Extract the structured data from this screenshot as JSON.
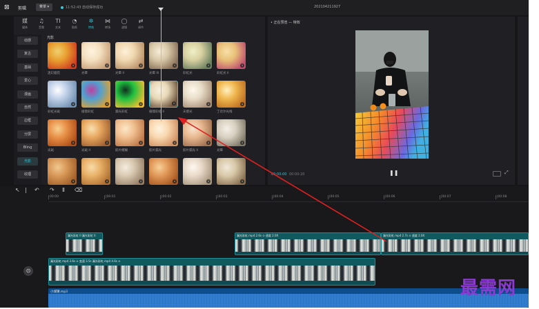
{
  "titlebar": {
    "app_name": "剪辑",
    "menu_label": "菜单 ▾",
    "save_status": "11:52:43 自动保存成功",
    "project_title": "202104211927"
  },
  "categories": [
    {
      "icon": "媒",
      "label": "媒体"
    },
    {
      "icon": "♫",
      "label": "音频"
    },
    {
      "icon": "TI",
      "label": "文本"
    },
    {
      "icon": "◔",
      "label": "贴纸"
    },
    {
      "icon": "✲",
      "label": "特效",
      "active": true
    },
    {
      "icon": "⋈",
      "label": "转场"
    },
    {
      "icon": "◯",
      "label": "滤镜"
    },
    {
      "icon": "⇄",
      "label": "调节"
    }
  ],
  "subnav": [
    "动感",
    "复古",
    "基础",
    "爱心",
    "漫画",
    "自然",
    "边框",
    "分屏",
    "Bling",
    "光影",
    "纹理"
  ],
  "subnav_active_index": 9,
  "grid_heading": "光影",
  "effects": [
    {
      "label": "迷幻烟花",
      "colors": [
        "#e8a030",
        "#d04020",
        "#f0d070"
      ]
    },
    {
      "label": "光晕",
      "colors": [
        "#f4e0c0",
        "#c8a078",
        "#fff4e0"
      ]
    },
    {
      "label": "光晕 II",
      "colors": [
        "#f0d8b0",
        "#b89068",
        "#fff0d8"
      ]
    },
    {
      "label": "光晕 III",
      "colors": [
        "#d8c8a8",
        "#8a7058",
        "#f8ecd8"
      ]
    },
    {
      "label": "彩虹光",
      "colors": [
        "#d8d0a0",
        "#6a8060",
        "#f0f0c8"
      ]
    },
    {
      "label": "彩虹光 II",
      "colors": [
        "#e8c078",
        "#c05070",
        "#f8e0a8"
      ]
    },
    {
      "label": "彩虹光斑",
      "colors": [
        "#c0d0e8",
        "#7090b0",
        "#ffffff"
      ]
    },
    {
      "label": "棱镜彩虹",
      "colors": [
        "#50a0d0",
        "#e0a030",
        "#c040a0"
      ]
    },
    {
      "label": "漏光彩虹",
      "colors": [
        "#20c040",
        "#f0c030",
        "#103020"
      ]
    },
    {
      "label": "棱镜彩虹 II",
      "colors": [
        "#e8d8b8",
        "#705840",
        "#f8f0e0"
      ]
    },
    {
      "label": "天使光",
      "colors": [
        "#e8dcc8",
        "#a89078",
        "#fff8ec"
      ]
    },
    {
      "label": "丁达尔光线",
      "colors": [
        "#f0b850",
        "#c07020",
        "#fff0c0"
      ]
    },
    {
      "label": "光斑",
      "colors": [
        "#e89048",
        "#b05018",
        "#f8d090"
      ]
    },
    {
      "label": "光斑 II",
      "colors": [
        "#e8a860",
        "#a06030",
        "#f8e0b0"
      ]
    },
    {
      "label": "胶片模糊",
      "colors": [
        "#f0c090",
        "#c07848",
        "#fce8c8"
      ]
    },
    {
      "label": "胶片漏光",
      "colors": [
        "#f8d8b0",
        "#d09060",
        "#fff4e0"
      ]
    },
    {
      "label": "胶片漏光 II",
      "colors": [
        "#e8b890",
        "#a07050",
        "#f8e4cc"
      ]
    },
    {
      "label": "光晕",
      "colors": [
        "#d8d0c0",
        "#807868",
        "#f4f0e8"
      ]
    },
    {
      "label": "",
      "colors": [
        "#d89858",
        "#a06028",
        "#f0c890"
      ]
    },
    {
      "label": "",
      "colors": [
        "#e8b068",
        "#b07030",
        "#f8dca8"
      ]
    },
    {
      "label": "",
      "colors": [
        "#d8c8b0",
        "#988068",
        "#f4ece0"
      ]
    },
    {
      "label": "",
      "colors": [
        "#e09858",
        "#a85820",
        "#f8d098"
      ]
    },
    {
      "label": "",
      "colors": [
        "#e8d8c8",
        "#a89880",
        "#fff8f0"
      ]
    },
    {
      "label": "",
      "colors": [
        "#d8c8a8",
        "#887050",
        "#f0e8d8"
      ]
    }
  ],
  "selected_effect_index": 9,
  "player": {
    "title": "• 正在预览 — 特效",
    "time_current": "00:00:00",
    "time_total": "00:00:20"
  },
  "timeline": {
    "ruler_ticks": [
      "00:00",
      "|00:01",
      "|00:02",
      "|00:03",
      "|00:04",
      "|00:05",
      "|00:06",
      "|00:07",
      "|00:08"
    ],
    "tools": [
      "↖",
      "|",
      "↶",
      "↷",
      "Ⅱ",
      "⌫"
    ],
    "clips": [
      {
        "label": "漏光彩虹 II 漏光彩虹 II"
      },
      {
        "label": "漏光彩虹.mp4  2.6s  ⊙  速度 2.0X"
      },
      {
        "label": "漏光彩虹.mp4  2.7s  ⊙  速度 2.0X"
      },
      {
        "label": "漏光彩虹.mp4  3.6s  ⊙ 变速  3.5s  漏光彩虹.mp4  4.6s  ⊙"
      }
    ],
    "audio_label": "小城镇.mp3",
    "main_track_icon": "⊙"
  },
  "watermark": "最需网",
  "colors": {
    "accent": "#36c8d8",
    "arrow": "#e02020",
    "background": "#161618"
  }
}
